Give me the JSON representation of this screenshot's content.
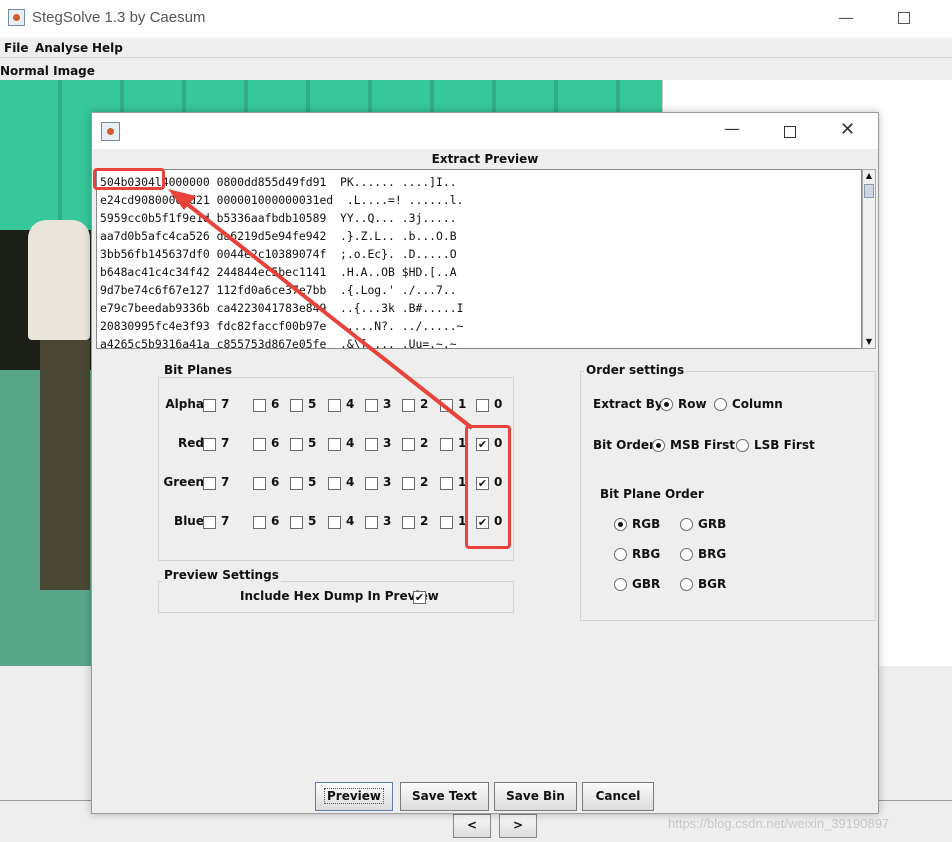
{
  "window": {
    "title": "StegSolve 1.3 by Caesum"
  },
  "menu": [
    "File",
    "Analyse",
    "Help"
  ],
  "image_label": "Normal Image",
  "nav": {
    "prev": "<",
    "next": ">"
  },
  "watermark": "https://blog.csdn.net/weixin_39190897",
  "dialog": {
    "preview_title": "Extract Preview",
    "preview_lines": [
      "504b0304l4000000 0800dd855d49fd91  PK...... ....]I..",
      "e24cd90800003d21 000001000000031ed  .L....=! ......l.",
      "5959cc0b5f1f9e1d b5336aafbdb10589  YY..Q... .3j.....",
      "aa7d0b5afc4ca526 da6219d5e94fe942  .}.Z.L.. .b...O.B",
      "3bb56fb145637df0 0044e2c10389074f  ;.o.Ec}. .D.....O",
      "b648ac41c4c34f42 244844ec5bec1141  .H.A..OB $HD.[..A",
      "9d7be74c6f67e127 112fd0a6ce37e7bb  .{.Log.' ./...7..",
      "e79c7beedab9336b ca4223041783e849  ..{...3k .B#.....I",
      "20830995fc4e3f93 fdc82faccf00b97e   ....N?. ../.....~",
      "a4265c5b9316a41a c855753d867e05fe  .&\\[.... .Uu=.~.~"
    ],
    "bit_planes": {
      "title": "Bit Planes",
      "rows": [
        {
          "name": "Alpha",
          "checked": []
        },
        {
          "name": "Red",
          "checked": [
            "0"
          ]
        },
        {
          "name": "Green",
          "checked": [
            "0"
          ]
        },
        {
          "name": "Blue",
          "checked": [
            "0"
          ]
        }
      ],
      "bits": [
        "7",
        "6",
        "5",
        "4",
        "3",
        "2",
        "1",
        "0"
      ]
    },
    "preview_settings": {
      "title": "Preview Settings",
      "hex_dump_label": "Include Hex Dump In Preview",
      "hex_dump_checked": true
    },
    "order_settings": {
      "title": "Order settings",
      "extract_by_label": "Extract By",
      "extract_by_options": [
        "Row",
        "Column"
      ],
      "extract_by_selected": "Row",
      "bit_order_label": "Bit Order",
      "bit_order_options": [
        "MSB First",
        "LSB First"
      ],
      "bit_order_selected": "MSB First",
      "plane_order_title": "Bit Plane Order",
      "plane_order_options": [
        "RGB",
        "GRB",
        "RBG",
        "BRG",
        "GBR",
        "BGR"
      ],
      "plane_order_selected": "RGB"
    },
    "buttons": [
      "Preview",
      "Save Text",
      "Save Bin",
      "Cancel"
    ]
  },
  "annotation_color": "#e8423a",
  "icons": [
    "app-icon",
    "dialog-app-icon",
    "minimize-icon",
    "maximize-icon",
    "close-icon"
  ]
}
